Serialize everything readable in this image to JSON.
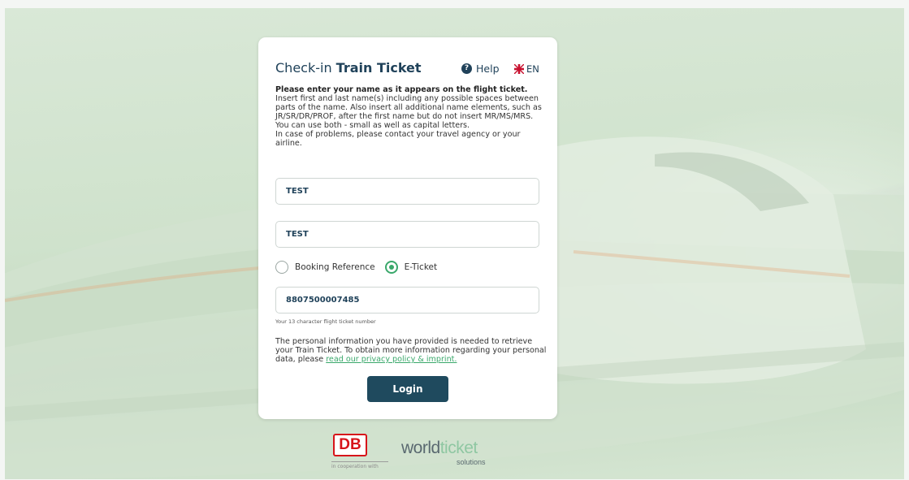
{
  "header": {
    "title_prefix": "Check-in",
    "title_bold": "Train Ticket",
    "help_label": "Help",
    "lang_label": "EN"
  },
  "instructions": {
    "bold": "Please enter your name as it appears on the flight ticket.",
    "body": "Insert first and last name(s) including any possible spaces between parts of the name. Also insert all additional name elements, such as JR/SR/DR/PROF, after the first name but do not insert MR/MS/MRS. You can use both - small as well as capital letters.",
    "problems": "In case of problems, please contact your travel agency or your airline."
  },
  "form": {
    "first_name_value": "TEST",
    "last_name_value": "TEST",
    "radio_booking_label": "Booking Reference",
    "radio_eticket_label": "E-Ticket",
    "selected_option": "E-Ticket",
    "ticket_number_value": "8807500007485",
    "ticket_hint": "Your 13 character flight ticket number"
  },
  "info": {
    "text": "The personal information you have provided is needed to retrieve your Train Ticket. To obtain more information regarding your personal data, please ",
    "link": "read our privacy policy & imprint."
  },
  "login_label": "Login",
  "footer": {
    "db_logo": "DB",
    "coop_text": "in cooperation with",
    "wt_world": "world",
    "wt_ticket": "ticket",
    "wt_sub": "solutions"
  },
  "colors": {
    "accent": "#3aa86b",
    "primary": "#1f4a5e",
    "db_red": "#d7141a"
  },
  "icons": {
    "help": "question-circle-icon",
    "lang": "uk-flag-icon"
  }
}
